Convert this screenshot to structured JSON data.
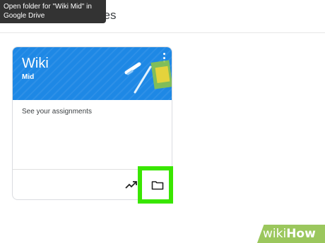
{
  "tooltip": {
    "text": "Open folder for \"Wiki Mid\" in Google Drive"
  },
  "page": {
    "heading_visible": "ses"
  },
  "card": {
    "title": "Wiki",
    "section": "Mid",
    "body_link": "See your assignments",
    "header_color": "#1e88e5",
    "footer_icons": [
      "trend-icon",
      "folder-icon"
    ]
  },
  "highlight": {
    "color": "#39e600"
  },
  "watermark": {
    "prefix": "wiki",
    "suffix": "How"
  }
}
